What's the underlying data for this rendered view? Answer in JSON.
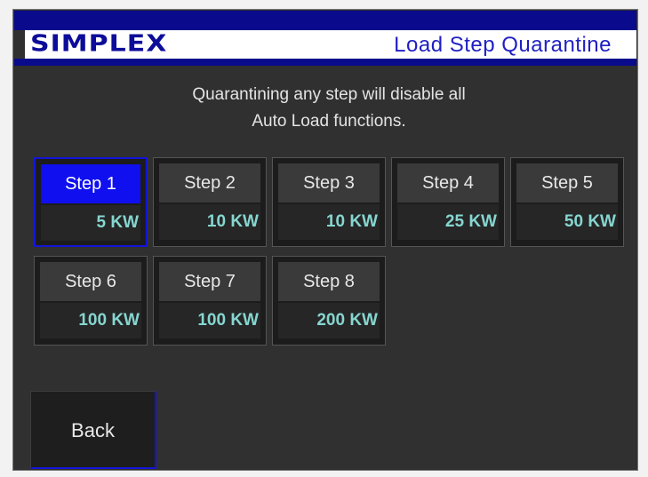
{
  "header": {
    "logo": "SIMPLEX",
    "title": "Load Step Quarantine"
  },
  "notice": {
    "line1": "Quarantining any step will disable all",
    "line2": "Auto Load functions."
  },
  "steps": [
    {
      "label": "Step 1",
      "load": "5 KW",
      "selected": true
    },
    {
      "label": "Step 2",
      "load": "10 KW",
      "selected": false
    },
    {
      "label": "Step 3",
      "load": "10 KW",
      "selected": false
    },
    {
      "label": "Step 4",
      "load": "25 KW",
      "selected": false
    },
    {
      "label": "Step 5",
      "load": "50 KW",
      "selected": false
    },
    {
      "label": "Step 6",
      "load": "100 KW",
      "selected": false
    },
    {
      "label": "Step 7",
      "load": "100 KW",
      "selected": false
    },
    {
      "label": "Step 8",
      "load": "200 KW",
      "selected": false
    }
  ],
  "back_label": "Back",
  "colors": {
    "brand_blue": "#0a0a8c",
    "selected_blue": "#0f0ff0",
    "load_text": "#86d6d0"
  }
}
